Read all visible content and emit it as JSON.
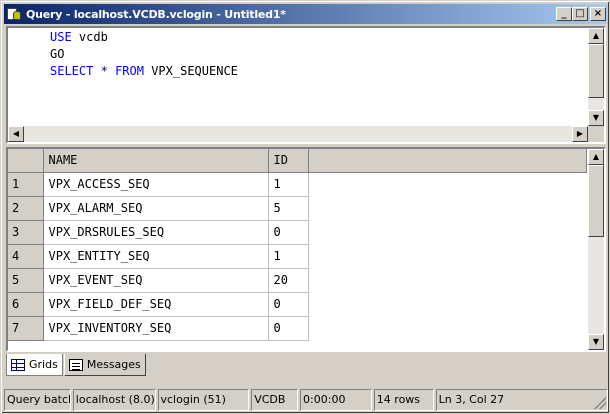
{
  "window": {
    "title": "Query - localhost.VCDB.vclogin - Untitled1*",
    "buttons": {
      "minimize": "_",
      "maximize": "□",
      "close": "×"
    }
  },
  "editor": {
    "lines": [
      [
        {
          "text": "USE",
          "cls": "kw"
        },
        {
          "text": " vcdb",
          "cls": ""
        }
      ],
      [
        {
          "text": "GO",
          "cls": ""
        }
      ],
      [
        {
          "text": "SELECT",
          "cls": "kw"
        },
        {
          "text": " ",
          "cls": ""
        },
        {
          "text": "*",
          "cls": "kw2"
        },
        {
          "text": " ",
          "cls": ""
        },
        {
          "text": "FROM",
          "cls": "kw"
        },
        {
          "text": " VPX_SEQUENCE",
          "cls": ""
        }
      ]
    ]
  },
  "results": {
    "columns": [
      "NAME",
      "ID"
    ],
    "rows": [
      {
        "num": "1",
        "name": "VPX_ACCESS_SEQ",
        "id": "1"
      },
      {
        "num": "2",
        "name": "VPX_ALARM_SEQ",
        "id": "5"
      },
      {
        "num": "3",
        "name": "VPX_DRSRULES_SEQ",
        "id": "0"
      },
      {
        "num": "4",
        "name": "VPX_ENTITY_SEQ",
        "id": "1"
      },
      {
        "num": "5",
        "name": "VPX_EVENT_SEQ",
        "id": "20"
      },
      {
        "num": "6",
        "name": "VPX_FIELD_DEF_SEQ",
        "id": "0"
      },
      {
        "num": "7",
        "name": "VPX_INVENTORY_SEQ",
        "id": "0"
      }
    ]
  },
  "tabs": [
    {
      "label": "Grids",
      "icon": "grid-icon",
      "active": true
    },
    {
      "label": "Messages",
      "icon": "messages-icon",
      "active": false
    }
  ],
  "status": [
    {
      "text": "Query batch c",
      "name": "status-query-batch"
    },
    {
      "text": "localhost (8.0)",
      "name": "status-server"
    },
    {
      "text": "vclogin (51)",
      "name": "status-login"
    },
    {
      "text": "VCDB",
      "name": "status-database"
    },
    {
      "text": "0:00:00",
      "name": "status-elapsed"
    },
    {
      "text": "14 rows",
      "name": "status-row-count"
    },
    {
      "text": "Ln 3, Col 27",
      "name": "status-cursor-position"
    }
  ],
  "scroll_arrows": {
    "up": "▲",
    "down": "▼",
    "left": "◀",
    "right": "▶"
  }
}
